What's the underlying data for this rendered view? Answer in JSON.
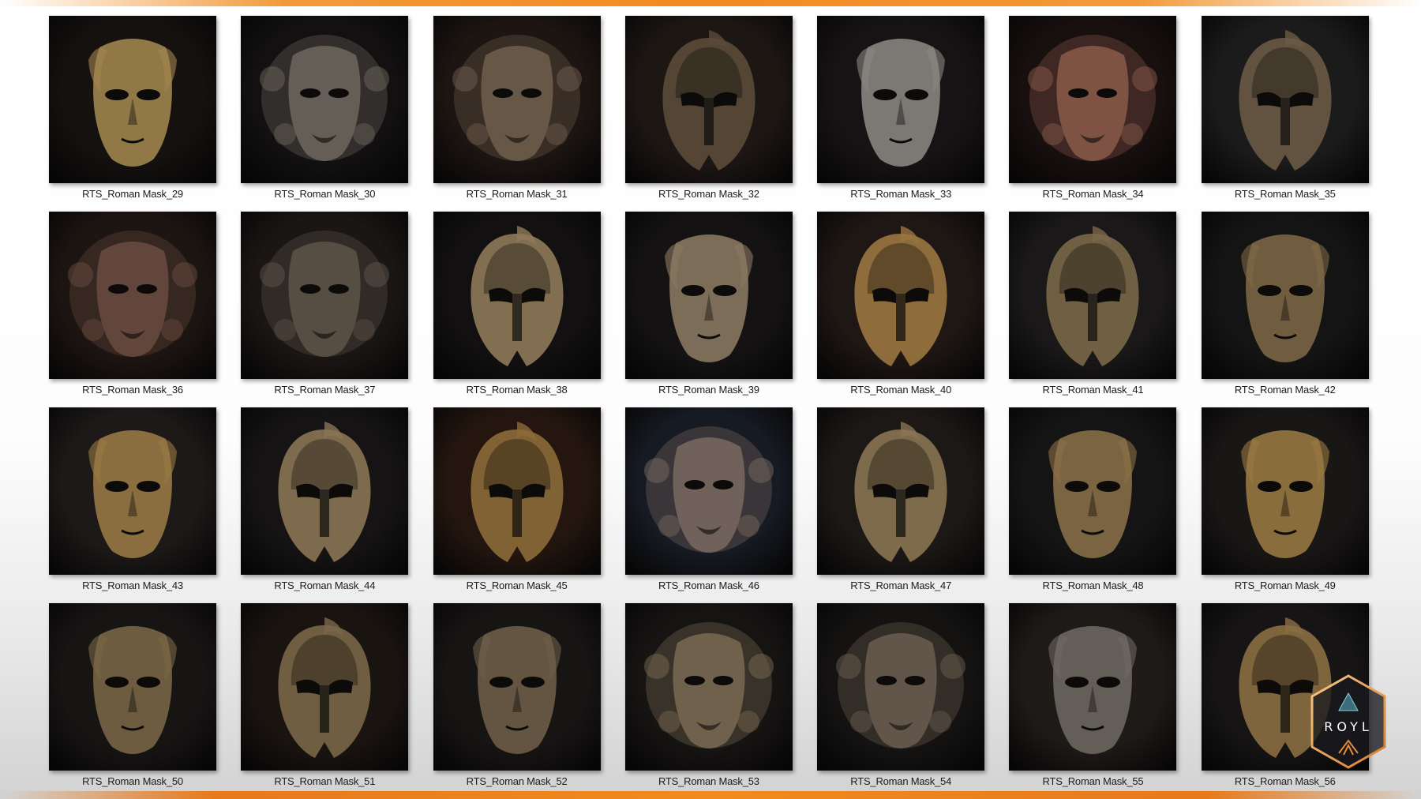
{
  "accent_color": "#f28a1f",
  "logo": {
    "text": "ROYL",
    "icon": "hexagon-logo"
  },
  "gallery": {
    "items": [
      {
        "label": "RTS_Roman Mask_29",
        "bg": "#14110f",
        "metal": "#a38650",
        "variant": 1
      },
      {
        "label": "RTS_Roman Mask_30",
        "bg": "#121010",
        "metal": "#6e665e",
        "variant": 2
      },
      {
        "label": "RTS_Roman Mask_31",
        "bg": "#1c1512",
        "metal": "#6f5e4e",
        "variant": 2
      },
      {
        "label": "RTS_Roman Mask_32",
        "bg": "#1d1714",
        "metal": "#5b4a39",
        "variant": 0
      },
      {
        "label": "RTS_Roman Mask_33",
        "bg": "#161314",
        "metal": "#8b8782",
        "variant": 1
      },
      {
        "label": "RTS_Roman Mask_34",
        "bg": "#180f0f",
        "metal": "#8a5a4a",
        "variant": 2
      },
      {
        "label": "RTS_Roman Mask_35",
        "bg": "#1b1b1c",
        "metal": "#6a5a45",
        "variant": 0
      },
      {
        "label": "RTS_Roman Mask_36",
        "bg": "#1d1512",
        "metal": "#6a4b40",
        "variant": 2
      },
      {
        "label": "RTS_Roman Mask_37",
        "bg": "#1a1614",
        "metal": "#5d5349",
        "variant": 2
      },
      {
        "label": "RTS_Roman Mask_38",
        "bg": "#121010",
        "metal": "#8f7a5a",
        "variant": 0
      },
      {
        "label": "RTS_Roman Mask_39",
        "bg": "#141212",
        "metal": "#8a7a62",
        "variant": 1
      },
      {
        "label": "RTS_Roman Mask_40",
        "bg": "#1e1714",
        "metal": "#9a7540",
        "variant": 0
      },
      {
        "label": "RTS_Roman Mask_41",
        "bg": "#1a1818",
        "metal": "#7a6848",
        "variant": 0
      },
      {
        "label": "RTS_Roman Mask_42",
        "bg": "#141414",
        "metal": "#7d6845",
        "variant": 1
      },
      {
        "label": "RTS_Roman Mask_43",
        "bg": "#1c1918",
        "metal": "#9a7a45",
        "variant": 1
      },
      {
        "label": "RTS_Roman Mask_44",
        "bg": "#151313",
        "metal": "#8a7555",
        "variant": 0
      },
      {
        "label": "RTS_Roman Mask_45",
        "bg": "#24160f",
        "metal": "#8c6a3a",
        "variant": 0
      },
      {
        "label": "RTS_Roman Mask_46",
        "bg": "#161a22",
        "metal": "#7a6a60",
        "variant": 2
      },
      {
        "label": "RTS_Roman Mask_47",
        "bg": "#1c1816",
        "metal": "#8a7452",
        "variant": 0
      },
      {
        "label": "RTS_Roman Mask_48",
        "bg": "#141414",
        "metal": "#8a7048",
        "variant": 1
      },
      {
        "label": "RTS_Roman Mask_49",
        "bg": "#191716",
        "metal": "#9a7a42",
        "variant": 1
      },
      {
        "label": "RTS_Roman Mask_50",
        "bg": "#171514",
        "metal": "#7a6645",
        "variant": 1
      },
      {
        "label": "RTS_Roman Mask_51",
        "bg": "#1a1411",
        "metal": "#7a6648",
        "variant": 0
      },
      {
        "label": "RTS_Roman Mask_52",
        "bg": "#171514",
        "metal": "#6e5e48",
        "variant": 1
      },
      {
        "label": "RTS_Roman Mask_53",
        "bg": "#161413",
        "metal": "#7a6a52",
        "variant": 2
      },
      {
        "label": "RTS_Roman Mask_54",
        "bg": "#141312",
        "metal": "#6a5e50",
        "variant": 2
      },
      {
        "label": "RTS_Roman Mask_55",
        "bg": "#1e1a18",
        "metal": "#6e6862",
        "variant": 1
      },
      {
        "label": "RTS_Roman Mask_56",
        "bg": "#161414",
        "metal": "#8a6e42",
        "variant": 0
      }
    ]
  }
}
